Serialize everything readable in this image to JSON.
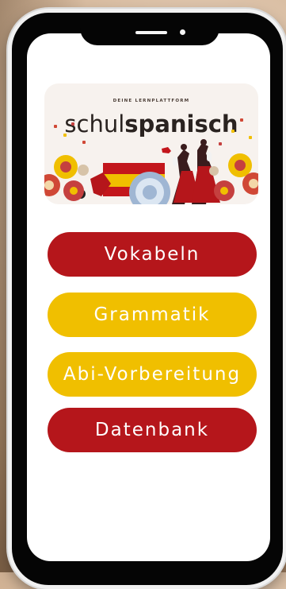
{
  "banner": {
    "tagline": "DEINE LERNPLATTFORM",
    "brand_light": "schul",
    "brand_bold": "spanisch"
  },
  "menu": {
    "items": [
      {
        "label": "Vokabeln",
        "color": "#b5161b"
      },
      {
        "label": "Grammatik",
        "color": "#f0bf00"
      },
      {
        "label": "Abi-Vorbereitung",
        "color": "#f0bf00"
      },
      {
        "label": "Datenbank",
        "color": "#b5161b"
      }
    ]
  }
}
